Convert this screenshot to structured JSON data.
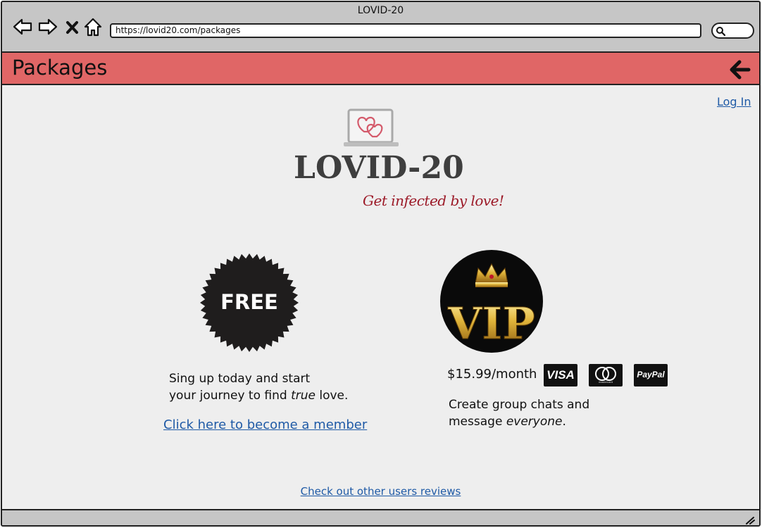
{
  "window": {
    "title": "LOVID-20"
  },
  "toolbar": {
    "back_icon": "back-arrow-icon",
    "forward_icon": "forward-arrow-icon",
    "close_icon": "close-x-icon",
    "home_icon": "home-icon",
    "url": "https://lovid20.com/packages",
    "search_icon": "magnifier-icon"
  },
  "header": {
    "title": "Packages",
    "back_icon": "back-arrow-icon"
  },
  "auth": {
    "login_label": "Log In"
  },
  "logo": {
    "wordmark": "LOVID-20",
    "tagline": "Get infected by love!"
  },
  "free_package": {
    "badge_text": "FREE",
    "desc_line1": "Sing up today and start",
    "desc_line2_pre": "your journey to find ",
    "desc_line2_em": "true",
    "desc_line2_post": " love.",
    "cta_label": "Click here to become a member"
  },
  "vip_package": {
    "badge_text": "VIP",
    "price": "$15.99/month",
    "payment_methods": [
      "VISA",
      "mastercard",
      "PayPal"
    ],
    "desc_line1": "Create group chats and",
    "desc_line2_pre": "message ",
    "desc_line2_em": "everyone",
    "desc_line2_post": "."
  },
  "footer": {
    "reviews_label": "Check out other users reviews"
  },
  "colors": {
    "header_band": "#e06666",
    "link": "#1f5aa6",
    "logo_text": "#3e3e3e",
    "tagline": "#9c1a28",
    "content_bg": "#eeeeee",
    "chrome_bg": "#c6c6c6"
  }
}
